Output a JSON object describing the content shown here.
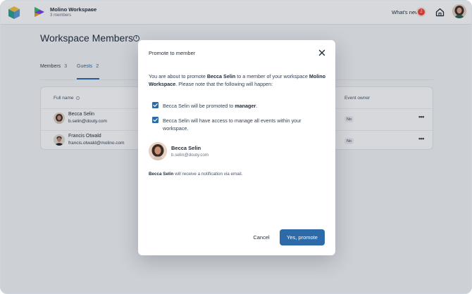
{
  "header": {
    "workspace_name": "Molino Workspace",
    "workspace_members": "3 members",
    "whats_new": "What's new",
    "notification_count": "2"
  },
  "page": {
    "title": "Workspace Members",
    "tabs": [
      {
        "label": "Members",
        "count": "3"
      },
      {
        "label": "Guests",
        "count": "2"
      }
    ],
    "table": {
      "columns": [
        "Full name",
        "Event owner"
      ],
      "rows": [
        {
          "name": "Becca Selin",
          "email": "b.selin@douty.com",
          "event_owner": "No"
        },
        {
          "name": "Francis Otwald",
          "email": "francis.otwald@molino.com",
          "event_owner": "No"
        }
      ]
    }
  },
  "modal": {
    "title": "Promote to member",
    "intro_1": "You are about to promote ",
    "intro_name": "Becca Selin",
    "intro_2": " to a member of your workspace ",
    "intro_workspace": "Molino Workspace",
    "intro_3": ". Please note that the following will happen:",
    "check_1_pre": "Becca Selin will be promoted to ",
    "check_1_role": "manager",
    "check_1_post": ".",
    "check_2": "Becca Selin will have access to manage all events within your workspace.",
    "user_name": "Becca Selin",
    "user_email": "b.selin@douty.com",
    "notify_name": "Becca Selin",
    "notify_text": " will receive a notification via email.",
    "cancel_label": "Cancel",
    "confirm_label": "Yes, promote"
  },
  "colors": {
    "accent": "#2d6aa8",
    "badge": "#f04438"
  },
  "icons": [
    "app-logo-icon",
    "workspace-logo-icon",
    "chevron-down-icon",
    "home-icon",
    "info-icon",
    "close-icon",
    "checkbox-checked-icon",
    "more-dots-icon"
  ]
}
